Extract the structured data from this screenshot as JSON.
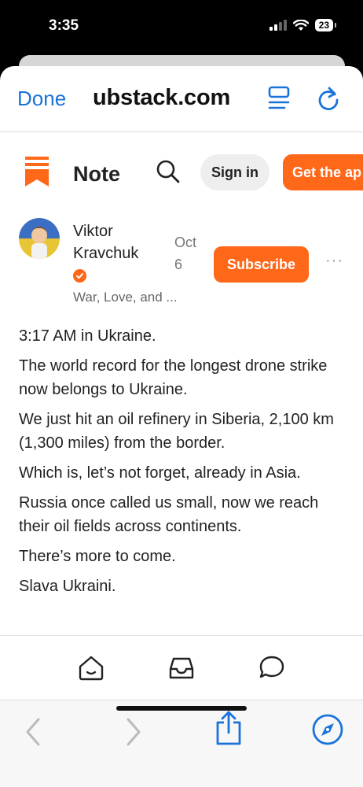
{
  "status": {
    "time": "3:35",
    "battery": "23"
  },
  "browser": {
    "done_label": "Done",
    "url": "ubstack.com"
  },
  "header": {
    "title": "Note",
    "sign_in_label": "Sign in",
    "get_app_label": "Get the ap"
  },
  "post": {
    "author_name": "Viktor Kravchuk",
    "publication": "War, Love, and ...",
    "date": "Oct 6",
    "subscribe_label": "Subscribe",
    "more_label": "···",
    "paragraphs": [
      "3:17 AM in Ukraine.",
      "The world record for the longest drone strike now belongs to Ukraine.",
      "We just hit an oil refinery in Siberia, 2,100 km (1,300 miles) from the border.",
      "Which is, let’s not forget, already in Asia.",
      "Russia once called us small, now we reach their oil fields across continents.",
      "There’s more to come.",
      "Slava Ukraini."
    ]
  },
  "icons": {
    "reader": "reader-icon",
    "reload": "reload-icon",
    "logo": "substack-logo-icon",
    "search": "search-icon",
    "home": "home-icon",
    "inbox": "inbox-icon",
    "chat": "chat-icon",
    "back": "back-icon",
    "forward": "forward-icon",
    "share": "share-icon",
    "compass": "compass-icon"
  },
  "colors": {
    "accent": "#ff6719",
    "link": "#1a73d9"
  }
}
